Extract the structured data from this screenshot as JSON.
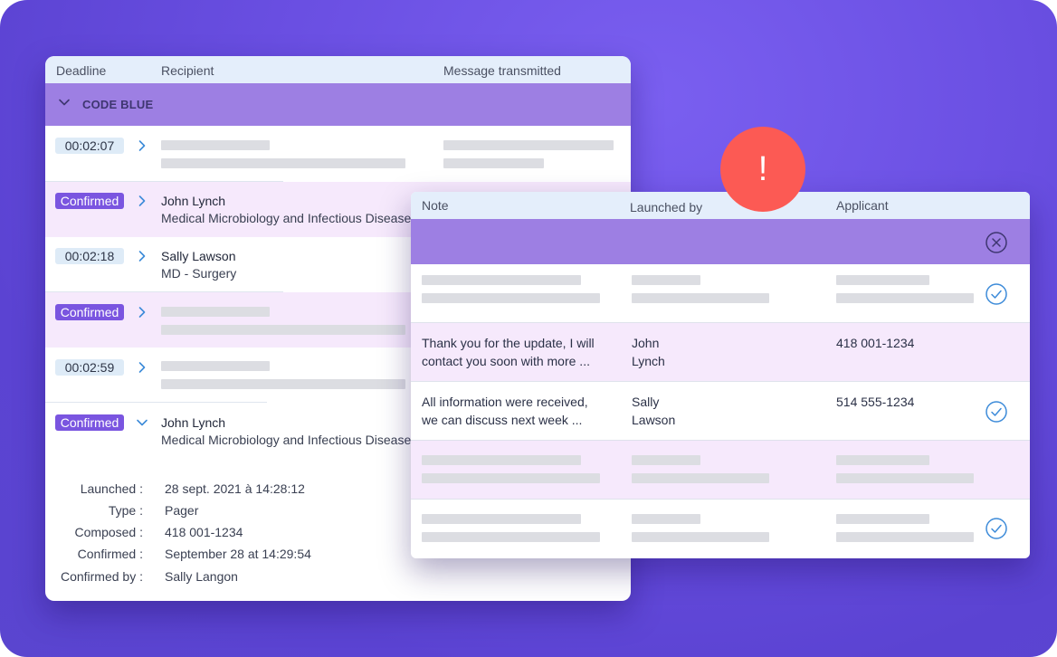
{
  "left_table": {
    "headers": {
      "deadline": "Deadline",
      "recipient": "Recipient",
      "message": "Message transmitted"
    },
    "group_label": "CODE BLUE",
    "rows": [
      {
        "badge": "00:02:07",
        "name": "",
        "dept": ""
      },
      {
        "badge": "Confirmed",
        "name": "John Lynch",
        "dept": "Medical Microbiology and Infectious Disease"
      },
      {
        "badge": "00:02:18",
        "name": "Sally Lawson",
        "dept": "MD - Surgery"
      },
      {
        "badge": "Confirmed",
        "name": "",
        "dept": ""
      },
      {
        "badge": "00:02:59",
        "name": "",
        "dept": ""
      },
      {
        "badge": "Confirmed",
        "name": "John Lynch",
        "dept": "Medical Microbiology and Infectious Disease"
      }
    ],
    "details": [
      {
        "label": "Launched :",
        "value": "28 sept. 2021 à 14:28:12"
      },
      {
        "label": "Type :",
        "value": "Pager"
      },
      {
        "label": "Composed :",
        "value": "418 001-1234"
      },
      {
        "label": "Confirmed :",
        "value": "September 28 at 14:29:54"
      },
      {
        "label": "Confirmed by :",
        "value": "Sally Langon"
      }
    ]
  },
  "right_table": {
    "headers": {
      "note": "Note",
      "launched_by": "Launched by",
      "applicant": "Applicant"
    },
    "rows": [
      {
        "note_1": "",
        "note_2": "",
        "by_1": "",
        "by_2": "",
        "applicant": "",
        "checked": true
      },
      {
        "note_1": "Thank you for the update, I will",
        "note_2": "contact you soon with more ...",
        "by_1": "John",
        "by_2": "Lynch",
        "applicant": "418 001-1234",
        "checked": false
      },
      {
        "note_1": "All information were received,",
        "note_2": "we can discuss next week ...",
        "by_1": "Sally",
        "by_2": "Lawson",
        "applicant": "514 555-1234",
        "checked": true
      },
      {
        "note_1": "",
        "note_2": "",
        "by_1": "",
        "by_2": "",
        "applicant": "",
        "checked": false
      },
      {
        "note_1": "",
        "note_2": "",
        "by_1": "",
        "by_2": "",
        "applicant": "",
        "checked": true
      }
    ]
  },
  "alert_symbol": "!",
  "colors": {
    "background": "#6a4fe2",
    "group_bar": "#9d7fe3",
    "confirmed_badge": "#7a55e0",
    "alert": "#fc5a54",
    "accent_blue": "#3d8bd9",
    "row_alt": "#f6e9fc"
  },
  "icons": {
    "row_expand": "chevron-right-icon",
    "row_collapse": "chevron-down-icon",
    "close": "close-circle-icon",
    "check": "check-circle-icon",
    "alert": "exclamation-icon"
  }
}
